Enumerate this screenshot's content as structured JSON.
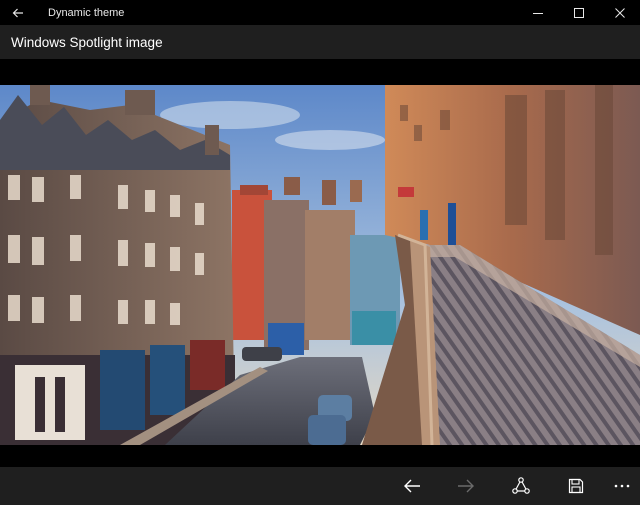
{
  "window": {
    "title": "Dynamic theme"
  },
  "header": {
    "title": "Windows Spotlight image"
  },
  "image": {
    "subject": "street-scene-photo"
  },
  "icons": {
    "back": "arrow-left-icon",
    "minimize": "minimize-icon",
    "maximize": "maximize-icon",
    "close": "close-icon",
    "previous": "arrow-left-icon",
    "next": "arrow-right-icon",
    "share": "share-icon",
    "save": "save-icon",
    "more": "ellipsis-icon"
  },
  "colors": {
    "titlebar": "#000000",
    "header": "#1f1f1f",
    "commandbar": "#1f1f1f",
    "text": "#ffffff",
    "disabled": "#6b6b6b"
  },
  "commandbar": {
    "next_enabled": false
  }
}
